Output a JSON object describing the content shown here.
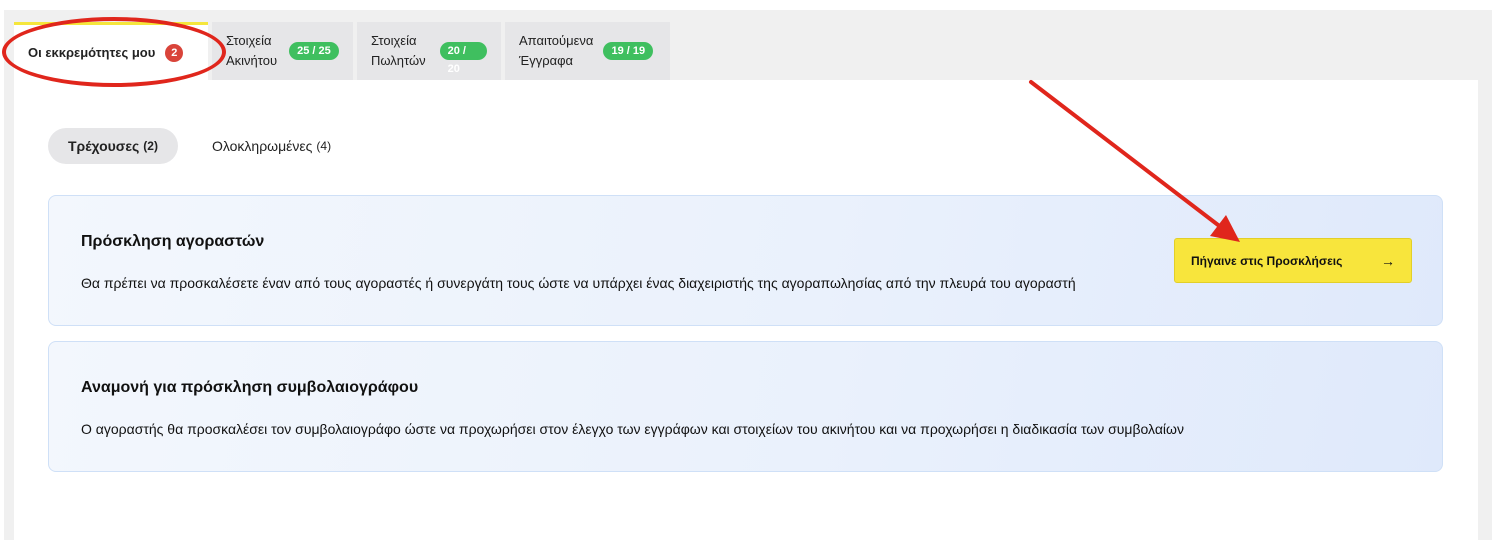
{
  "tabs": [
    {
      "label": "Οι εκκρεμότητες μου",
      "badge": "2"
    },
    {
      "label_line1": "Στοιχεία",
      "label_line2": "Ακινήτου",
      "badge": "25 / 25"
    },
    {
      "label_line1": "Στοιχεία",
      "label_line2": "Πωλητών",
      "badge": "20 / 20"
    },
    {
      "label_line1": "Απαιτούμενα",
      "label_line2": "Έγγραφα",
      "badge": "19 / 19"
    }
  ],
  "subtabs": [
    {
      "label": "Τρέχουσες",
      "count": "(2)"
    },
    {
      "label": "Ολοκληρωμένες",
      "count": "(4)"
    }
  ],
  "cards": [
    {
      "title": "Πρόσκληση αγοραστών",
      "text": "Θα πρέπει να προσκαλέσετε έναν από τους αγοραστές ή συνεργάτη τους ώστε να υπάρχει ένας διαχειριστής της αγοραπωλησίας από την πλευρά του αγοραστή",
      "button_label": "Πήγαινε στις Προσκλήσεις"
    },
    {
      "title": "Αναμονή για πρόσκληση συμβολαιογράφου",
      "text": "Ο αγοραστής θα προσκαλέσει τον συμβολαιογράφο ώστε να προχωρήσει στον έλεγχο των εγγράφων και στοιχείων του ακινήτου και να προχωρήσει η διαδικασία των συμβολαίων"
    }
  ],
  "colors": {
    "accent_yellow": "#f8e53c",
    "badge_red": "#d9443a",
    "badge_green": "#3fbf5f",
    "annotation_red": "#e0261c"
  },
  "icons": {
    "button_arrow": "arrow-right-icon"
  }
}
